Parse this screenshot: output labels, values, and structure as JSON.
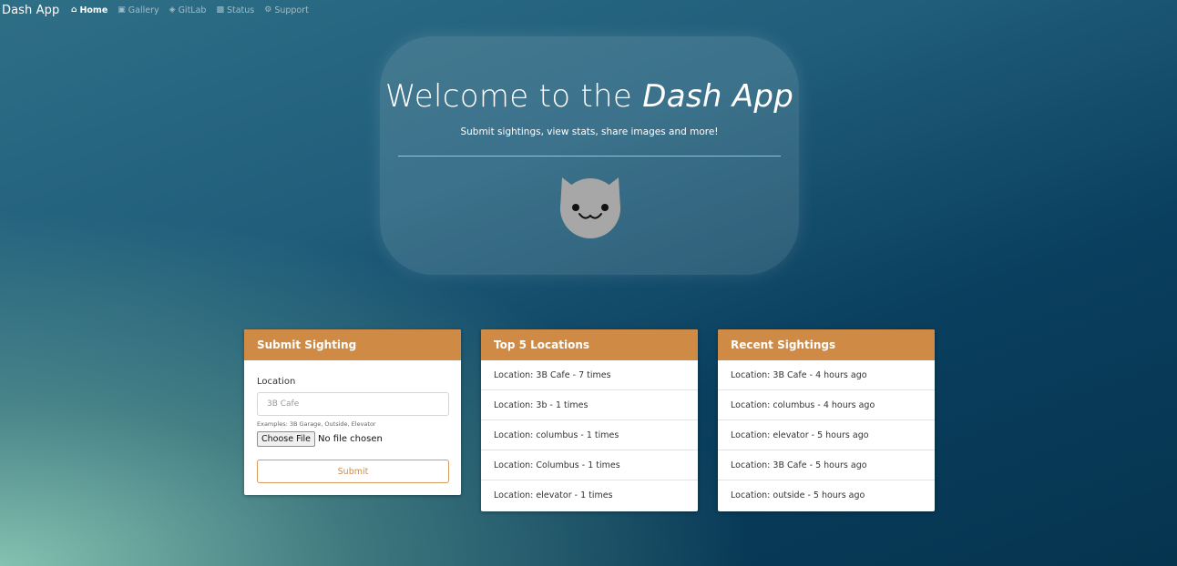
{
  "navbar": {
    "brand": "Dash App",
    "links": [
      {
        "label": "Home",
        "icon": "home-icon",
        "active": true
      },
      {
        "label": "Gallery",
        "icon": "image-icon",
        "active": false
      },
      {
        "label": "GitLab",
        "icon": "gitlab-icon",
        "active": false
      },
      {
        "label": "Status",
        "icon": "chart-icon",
        "active": false
      },
      {
        "label": "Support",
        "icon": "gear-icon",
        "active": false
      }
    ]
  },
  "hero": {
    "title_prefix": "Welcome to the ",
    "title_emphasis": "Dash App",
    "subtitle": "Submit sightings, view stats, share images and more!",
    "mascot_icon": "cat-icon"
  },
  "submit_card": {
    "title": "Submit Sighting",
    "location_label": "Location",
    "location_placeholder": "3B Cafe",
    "help_text": "Examples: 3B Garage, Outside, Elevator",
    "file_button": "Choose File",
    "file_status": "No file chosen",
    "submit_label": "Submit"
  },
  "top_locations": {
    "title": "Top 5 Locations",
    "items": [
      "Location: 3B Cafe - 7 times",
      "Location: 3b - 1 times",
      "Location: columbus - 1 times",
      "Location: Columbus - 1 times",
      "Location: elevator - 1 times"
    ]
  },
  "recent_sightings": {
    "title": "Recent Sightings",
    "items": [
      "Location: 3B Cafe - 4 hours ago",
      "Location: columbus - 4 hours ago",
      "Location: elevator - 5 hours ago",
      "Location: 3B Cafe - 5 hours ago",
      "Location: outside - 5 hours ago"
    ]
  },
  "colors": {
    "accent": "#cf8b45",
    "background_dark": "#05344f",
    "background_light": "#8cc8b4"
  }
}
